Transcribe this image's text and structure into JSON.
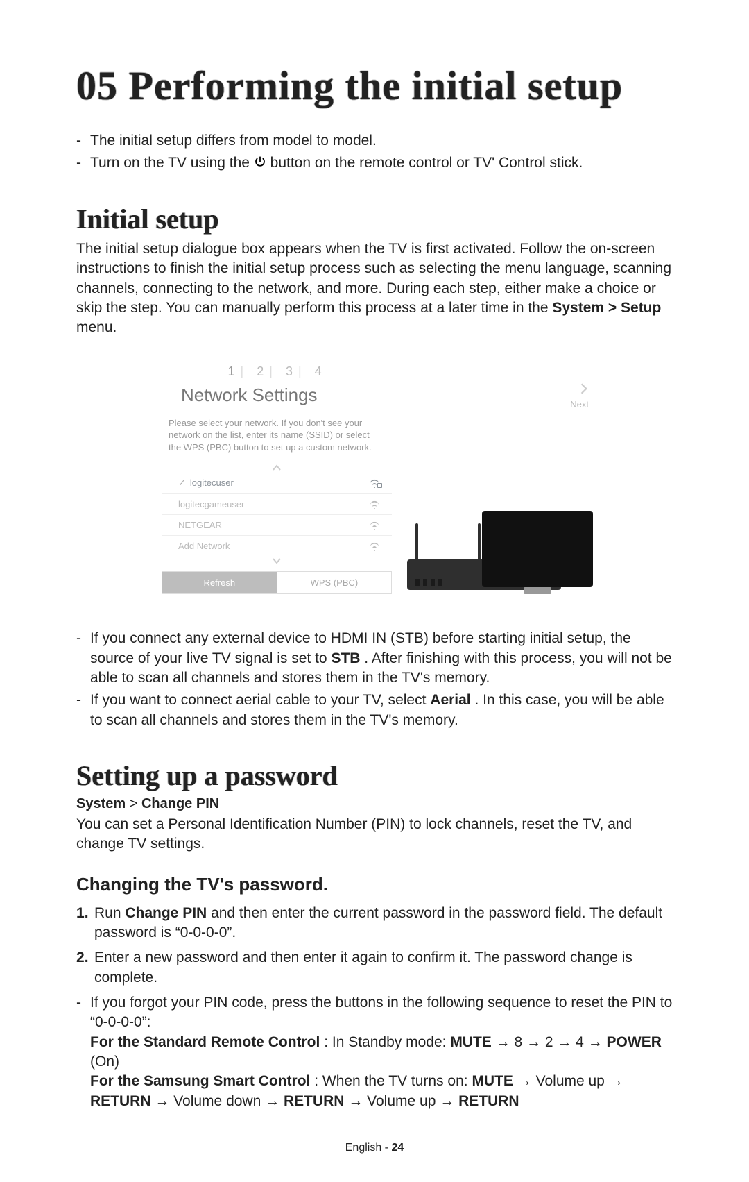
{
  "chapter_title": "05 Performing the initial setup",
  "intro_bullets": [
    "The initial setup differs from model to model.",
    "Turn on the TV using the [power] button on the remote control or TV' Control stick."
  ],
  "power_icon_label_parts": {
    "before": "Turn on the TV using the ",
    "after": " button on the remote control or TV' Control stick."
  },
  "initial_setup_heading": "Initial setup",
  "initial_setup_para_parts": {
    "before": "The initial setup dialogue box appears when the TV is first activated. Follow the on-screen instructions to finish the initial setup process such as selecting the menu language, scanning channels, connecting to the network, and more. During each step, either make a choice or skip the step. You can manually perform this process at a later time in the ",
    "bold": "System > Setup",
    "after": " menu."
  },
  "figure": {
    "steps": [
      "1",
      "2",
      "3",
      "4"
    ],
    "title": "Network Settings",
    "description": "Please select your network. If you don't see your network on the list, enter its name (SSID) or select the WPS (PBC) button to set up a custom network.",
    "networks": [
      {
        "name": "logitecuser",
        "selected": true,
        "locked": true
      },
      {
        "name": "logitecgameuser",
        "selected": false,
        "locked": false
      },
      {
        "name": "NETGEAR",
        "selected": false,
        "locked": false
      },
      {
        "name": "Add Network",
        "selected": false,
        "locked": false
      }
    ],
    "refresh_label": "Refresh",
    "wps_label": "WPS (PBC)",
    "next_label": "Next"
  },
  "post_figure_bullets": [
    {
      "before": "If you connect any external device to HDMI IN (STB) before starting initial setup, the source of your live TV signal is set to ",
      "bold": "STB",
      "after": ". After finishing with this process, you will not be able to scan all channels and stores them in the TV's memory."
    },
    {
      "before": "If you want to connect aerial cable to your TV, select ",
      "bold": "Aerial",
      "after": ". In this case, you will be able to scan all channels and stores them in the TV's memory."
    }
  ],
  "password_heading": "Setting up a password",
  "password_breadcrumb": {
    "a": "System",
    "sep": ">",
    "b": "Change PIN"
  },
  "password_para": "You can set a Personal Identification Number (PIN) to lock channels, reset the TV, and change TV settings.",
  "change_heading": "Changing the TV's password.",
  "change_steps": [
    {
      "before": "Run ",
      "bold": "Change PIN",
      "after": " and then enter the current password in the password field. The default password is “0-0-0-0”."
    },
    {
      "text": "Enter a new password and then enter it again to confirm it. The password change is complete."
    }
  ],
  "forgot": {
    "intro": "If you forgot your PIN code, press the buttons in the following sequence to reset the PIN to “0-0-0-0”:",
    "standard_label": "For the Standard Remote Control",
    "standard_rest": ": In Standby mode: ",
    "standard_seq_bold1": "MUTE",
    "standard_seq_mid": " → 8 → 2 → 4 → ",
    "standard_seq_bold2": "POWER",
    "standard_seq_tail": " (On)",
    "smart_label": "For the Samsung Smart Control",
    "smart_rest": ": When the TV turns on: ",
    "smart_a": "MUTE",
    "arrow": " → ",
    "smart_b": "Volume up",
    "smart_c": "RETURN",
    "smart_d": "Volume down",
    "smart_e": "RETURN",
    "smart_f": "Volume up",
    "smart_g": "RETURN"
  },
  "footer": {
    "lang": "English",
    "sep": " - ",
    "page": "24"
  }
}
